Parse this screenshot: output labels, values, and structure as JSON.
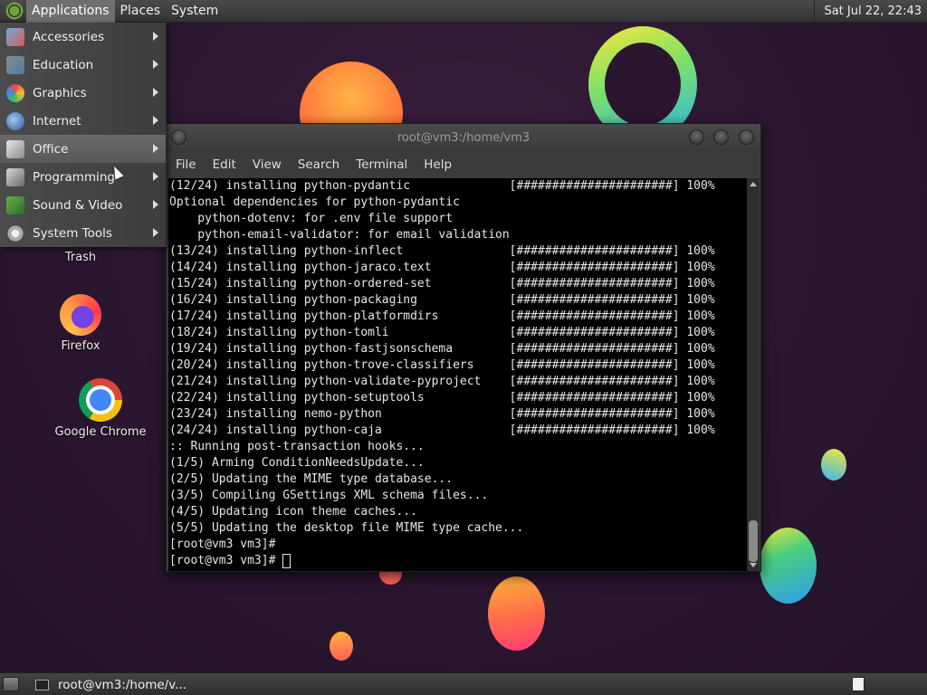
{
  "top_panel": {
    "menus": [
      "Applications",
      "Places",
      "System"
    ],
    "clock": "Sat Jul 22, 22:43"
  },
  "app_menu": {
    "items": [
      {
        "label": "Accessories",
        "icon": "accessories-icon"
      },
      {
        "label": "Education",
        "icon": "education-icon"
      },
      {
        "label": "Graphics",
        "icon": "graphics-icon"
      },
      {
        "label": "Internet",
        "icon": "internet-icon"
      },
      {
        "label": "Office",
        "icon": "office-icon"
      },
      {
        "label": "Programming",
        "icon": "programming-icon"
      },
      {
        "label": "Sound & Video",
        "icon": "sound-video-icon"
      },
      {
        "label": "System Tools",
        "icon": "system-tools-icon"
      }
    ]
  },
  "desktop": {
    "icons": [
      {
        "label": "Trash"
      },
      {
        "label": "Firefox"
      },
      {
        "label": "Google Chrome"
      }
    ]
  },
  "terminal": {
    "title": "root@vm3:/home/vm3",
    "menus": [
      "File",
      "Edit",
      "View",
      "Search",
      "Terminal",
      "Help"
    ],
    "lines": [
      "(12/24) installing python-pydantic              [######################] 100%",
      "Optional dependencies for python-pydantic",
      "    python-dotenv: for .env file support",
      "    python-email-validator: for email validation",
      "(13/24) installing python-inflect               [######################] 100%",
      "(14/24) installing python-jaraco.text           [######################] 100%",
      "(15/24) installing python-ordered-set           [######################] 100%",
      "(16/24) installing python-packaging             [######################] 100%",
      "(17/24) installing python-platformdirs          [######################] 100%",
      "(18/24) installing python-tomli                 [######################] 100%",
      "(19/24) installing python-fastjsonschema        [######################] 100%",
      "(20/24) installing python-trove-classifiers     [######################] 100%",
      "(21/24) installing python-validate-pyproject    [######################] 100%",
      "(22/24) installing python-setuptools            [######################] 100%",
      "(23/24) installing nemo-python                  [######################] 100%",
      "(24/24) installing python-caja                  [######################] 100%",
      ":: Running post-transaction hooks...",
      "(1/5) Arming ConditionNeedsUpdate...",
      "(2/5) Updating the MIME type database...",
      "(3/5) Compiling GSettings XML schema files...",
      "(4/5) Updating icon theme caches...",
      "(5/5) Updating the desktop file MIME type cache...",
      "[root@vm3 vm3]#"
    ],
    "prompt": "[root@vm3 vm3]# "
  },
  "bottom_panel": {
    "task_label": "root@vm3:/home/v..."
  }
}
